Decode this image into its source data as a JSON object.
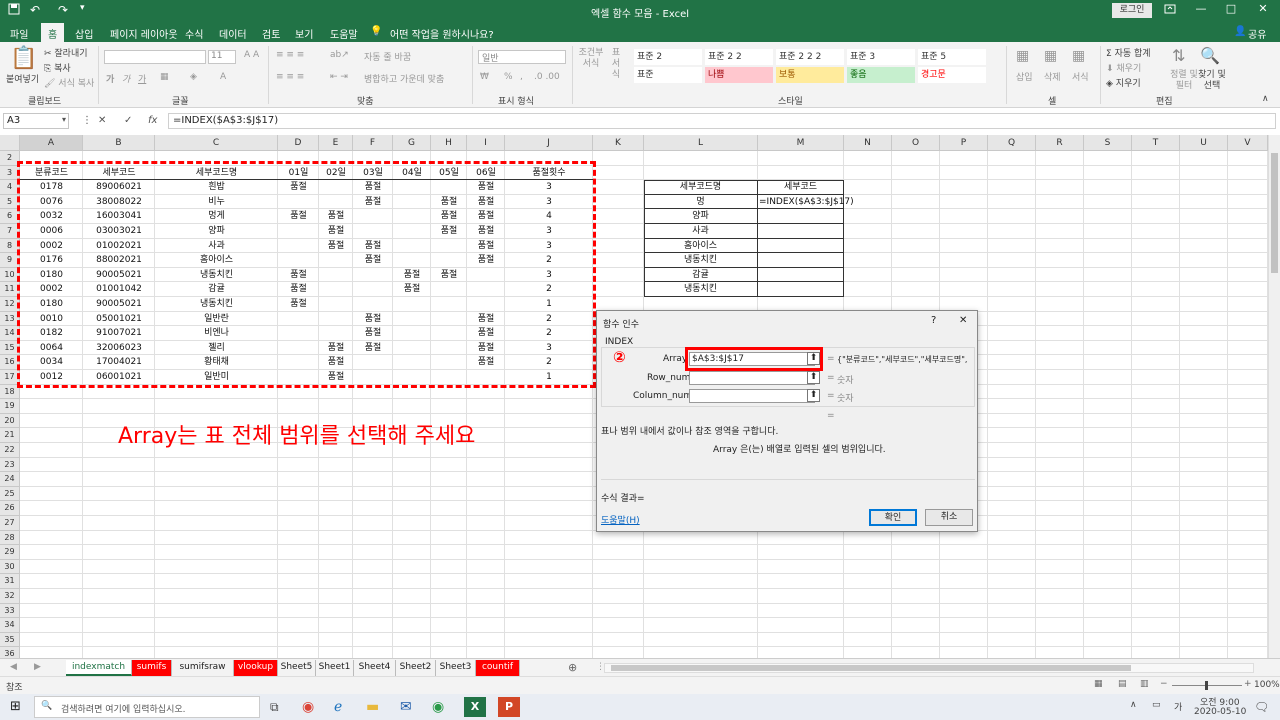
{
  "title_bar": {
    "document_title": "엑셀 함수 모음 - Excel",
    "login_label": "로그인",
    "window_controls": [
      "—",
      "□",
      "✕"
    ],
    "restore_icon": "□",
    "quick_access_icons": [
      "save-icon",
      "undo-icon",
      "redo-icon",
      "customize-icon"
    ]
  },
  "menu": {
    "tabs": [
      "파일",
      "홈",
      "삽입",
      "페이지 레이아웃",
      "수식",
      "데이터",
      "검토",
      "보기",
      "도움말"
    ],
    "active_tab": "홈",
    "tell_me": "어떤 작업을 원하시나요?",
    "share": "공유"
  },
  "ribbon": {
    "clipboard": {
      "paste": "붙여넣기",
      "cut": "잘라내기",
      "copy": "복사",
      "format_painter": "서식 복사",
      "group_label": "클립보드"
    },
    "font": {
      "font_size": "11",
      "group_label": "글꼴"
    },
    "alignment": {
      "wrap": "자동 줄 바꿈",
      "merge": "병합하고 가운데 맞춤",
      "group_label": "맞춤"
    },
    "number": {
      "format": "일반",
      "percent": "%",
      "comma": ",",
      "group_label": "표시 형식"
    },
    "styles": {
      "conditional": "조건부 서식",
      "table": "표 서식",
      "cells": [
        [
          "표준 2",
          "표준 2 2",
          "표준 2 2 2",
          "표준 3",
          "표준 5"
        ],
        [
          "표준",
          "나쁨",
          "보통",
          "좋음",
          "경고문"
        ]
      ],
      "group_label": "스타일"
    },
    "cells": {
      "insert": "삽입",
      "delete": "삭제",
      "format": "서식",
      "group_label": "셀"
    },
    "editing": {
      "autosum": "자동 합계",
      "fill": "채우기",
      "clear": "지우기",
      "sort": "정렬 및 필터",
      "find": "찾기 및 선택",
      "group_label": "편집"
    }
  },
  "formula_bar": {
    "name_box": "A3",
    "cancel": "✕",
    "enter": "✓",
    "fx": "fx",
    "formula": "=INDEX($A$3:$J$17)"
  },
  "grid": {
    "columns": [
      "A",
      "B",
      "C",
      "D",
      "E",
      "F",
      "G",
      "H",
      "I",
      "J",
      "K",
      "L",
      "M",
      "N",
      "O",
      "P",
      "Q",
      "R",
      "S",
      "T",
      "U",
      "V"
    ],
    "rows": [
      "2",
      "3",
      "4",
      "5",
      "6",
      "7",
      "8",
      "9",
      "10",
      "11",
      "12",
      "13",
      "14",
      "15",
      "16",
      "17",
      "18",
      "19",
      "20",
      "21",
      "22",
      "23",
      "24",
      "25",
      "26",
      "27",
      "28",
      "29",
      "30",
      "31",
      "32",
      "33",
      "34",
      "35",
      "36"
    ],
    "table_headers": [
      "분류코드",
      "세부코드",
      "세부코드명",
      "01일",
      "02일",
      "03일",
      "04일",
      "05일",
      "06일",
      "품절횟수"
    ],
    "table_rows": [
      [
        "0178",
        "89006021",
        "흰밥",
        "품절",
        "",
        "품절",
        "",
        "",
        "품절",
        "3"
      ],
      [
        "0076",
        "38008022",
        "비누",
        "",
        "",
        "품절",
        "",
        "품절",
        "품절",
        "3"
      ],
      [
        "0032",
        "16003041",
        "멍게",
        "품절",
        "품절",
        "",
        "",
        "품절",
        "품절",
        "4"
      ],
      [
        "0006",
        "03003021",
        "양파",
        "",
        "품절",
        "",
        "",
        "품절",
        "품절",
        "3"
      ],
      [
        "0002",
        "01002021",
        "사과",
        "",
        "품절",
        "품절",
        "",
        "",
        "품절",
        "3"
      ],
      [
        "0176",
        "88002021",
        "홈아이스",
        "",
        "",
        "품절",
        "",
        "",
        "품절",
        "2"
      ],
      [
        "0180",
        "90005021",
        "냉동치킨",
        "품절",
        "",
        "",
        "품절",
        "품절",
        "",
        "3"
      ],
      [
        "0002",
        "01001042",
        "감귤",
        "품절",
        "",
        "",
        "품절",
        "",
        "",
        "2"
      ],
      [
        "0180",
        "90005021",
        "냉동치킨",
        "품절",
        "",
        "",
        "",
        "",
        "",
        "1"
      ],
      [
        "0010",
        "05001021",
        "일반란",
        "",
        "",
        "품절",
        "",
        "",
        "품절",
        "2"
      ],
      [
        "0182",
        "91007021",
        "비엔나",
        "",
        "",
        "품절",
        "",
        "",
        "품절",
        "2"
      ],
      [
        "0064",
        "32006023",
        "젤리",
        "",
        "품절",
        "품절",
        "",
        "",
        "품절",
        "3"
      ],
      [
        "0034",
        "17004021",
        "황태채",
        "",
        "품절",
        "",
        "",
        "",
        "품절",
        "2"
      ],
      [
        "0012",
        "06001021",
        "일반미",
        "",
        "품절",
        "",
        "",
        "",
        "",
        "1"
      ]
    ],
    "lookup_headers": [
      "세부코드명",
      "세부코드"
    ],
    "lookup_rows": [
      [
        "멍",
        "=INDEX($A$3:$J$17)"
      ],
      [
        "양파",
        ""
      ],
      [
        "사과",
        ""
      ],
      [
        "홈아이스",
        ""
      ],
      [
        "냉동치킨",
        ""
      ],
      [
        "감귤",
        ""
      ],
      [
        "냉동치킨",
        ""
      ]
    ],
    "annotation": "Array는 표 전체 범위를 선택해 주세요"
  },
  "dialog": {
    "title": "함수 인수",
    "help_icon": "?",
    "close_icon": "✕",
    "function_name": "INDEX",
    "step_marker": "②",
    "args": [
      {
        "name": "Array",
        "value": "$A$3:$J$17",
        "result": "{\"분류코드\",\"세부코드\",\"세부코드명\","
      },
      {
        "name": "Row_num",
        "value": "",
        "result": "숫자"
      },
      {
        "name": "Column_num",
        "value": "",
        "result": "숫자"
      }
    ],
    "equals": "=",
    "description": "표나 범위 내에서 값이나 참조 영역을 구합니다.",
    "arg_description": "Array  은(는) 배열로 입력된 셀의 범위입니다.",
    "result_label": "수식 결과=",
    "help_link": "도움말(H)",
    "ok": "확인",
    "cancel": "취소"
  },
  "sheet_tabs": {
    "tabs": [
      {
        "name": "indexmatch",
        "style": "active"
      },
      {
        "name": "sumifs",
        "style": "red"
      },
      {
        "name": "sumifsraw",
        "style": "normal"
      },
      {
        "name": "vlookup",
        "style": "red"
      },
      {
        "name": "Sheet5",
        "style": "normal"
      },
      {
        "name": "Sheet1",
        "style": "normal"
      },
      {
        "name": "Sheet4",
        "style": "normal"
      },
      {
        "name": "Sheet2",
        "style": "normal"
      },
      {
        "name": "Sheet3",
        "style": "normal"
      },
      {
        "name": "countif",
        "style": "red"
      }
    ],
    "add_icon": "⊕"
  },
  "status_bar": {
    "mode": "참조",
    "zoom": "100%"
  },
  "taskbar": {
    "search_placeholder": "검색하려면 여기에 입력하십시오.",
    "time": "오전 9:00",
    "date": "2020-05-10"
  },
  "colors": {
    "excel_green": "#217346",
    "annotation_red": "#ff0000",
    "dialog_bg": "#f0f0f0"
  }
}
